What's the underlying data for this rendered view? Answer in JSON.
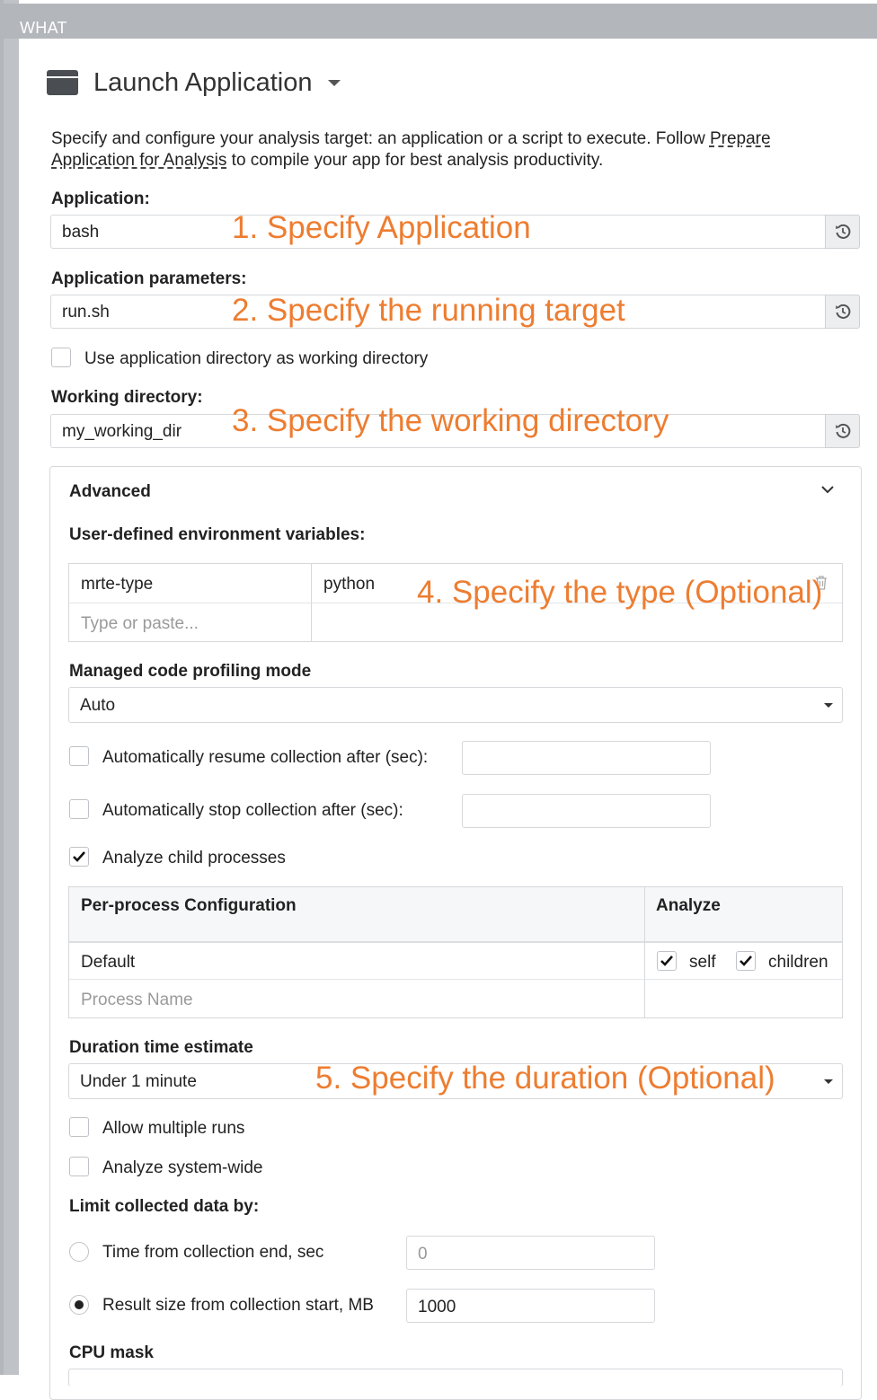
{
  "section": {
    "label": "WHAT"
  },
  "header": {
    "icon": "application-window-icon",
    "title": "Launch Application"
  },
  "description": {
    "text_before": "Specify and configure your analysis target: an application or a script to execute. Follow ",
    "link": "Prepare Application for Analysis",
    "text_after": " to compile your app for best analysis productivity."
  },
  "fields": {
    "application": {
      "label": "Application:",
      "value": "bash"
    },
    "app_params": {
      "label": "Application parameters:",
      "value": "run.sh"
    },
    "use_app_dir": {
      "label": "Use application directory as working directory",
      "checked": false
    },
    "working_dir": {
      "label": "Working directory:",
      "value": "my_working_dir"
    }
  },
  "annotations": {
    "a1": "1. Specify Application",
    "a2": "2. Specify the running target",
    "a3": "3. Specify the working directory",
    "a4": "4. Specify the type (Optional)",
    "a5": "5. Specify the duration (Optional)"
  },
  "advanced": {
    "title": "Advanced",
    "env_label": "User-defined environment variables:",
    "env": {
      "name": "mrte-type",
      "value": "python",
      "placeholder": "Type or paste..."
    },
    "managed_mode": {
      "label": "Managed code profiling mode",
      "value": "Auto"
    },
    "auto_resume": {
      "label": "Automatically resume collection after (sec):",
      "checked": false,
      "value": ""
    },
    "auto_stop": {
      "label": "Automatically stop collection after (sec):",
      "checked": false,
      "value": ""
    },
    "analyze_child": {
      "label": "Analyze child processes",
      "checked": true
    },
    "proc_table": {
      "col_config": "Per-process Configuration",
      "col_analyze": "Analyze",
      "row_default": "Default",
      "self_label": "self",
      "children_label": "children",
      "placeholder": "Process Name"
    },
    "duration": {
      "label": "Duration time estimate",
      "value": "Under 1 minute"
    },
    "allow_multiple": {
      "label": "Allow multiple runs",
      "checked": false
    },
    "system_wide": {
      "label": "Analyze system-wide",
      "checked": false
    },
    "limit": {
      "label": "Limit collected data by:",
      "time_label": "Time from collection end, sec",
      "time_value": "0",
      "size_label": "Result size from collection start, MB",
      "size_value": "1000",
      "selected": "size"
    },
    "cpu_mask": {
      "label": "CPU mask"
    }
  },
  "colors": {
    "annotation": "#ed7d31",
    "frame": "#b3b6bb"
  }
}
